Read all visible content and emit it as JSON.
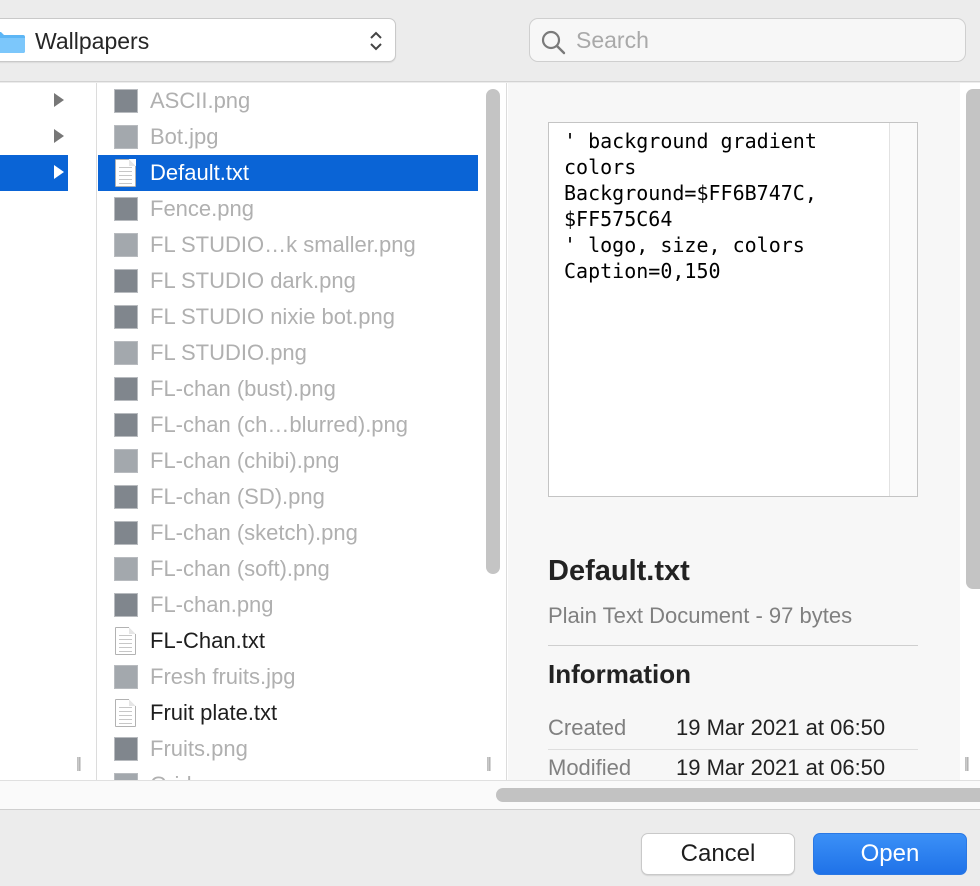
{
  "toolbar": {
    "location": "Wallpapers",
    "search_placeholder": "Search"
  },
  "colors": {
    "selection": "#0a64d6",
    "primary_button": "#1f72e8",
    "disabled_text": "#b0b0b0"
  },
  "files": [
    {
      "name": "ASCII.png",
      "kind": "image",
      "enabled": false,
      "selected": false
    },
    {
      "name": "Bot.jpg",
      "kind": "image",
      "enabled": false,
      "selected": false
    },
    {
      "name": "Default.txt",
      "kind": "text",
      "enabled": true,
      "selected": true
    },
    {
      "name": "Fence.png",
      "kind": "image",
      "enabled": false,
      "selected": false
    },
    {
      "name": "FL STUDIO…k smaller.png",
      "kind": "image",
      "enabled": false,
      "selected": false
    },
    {
      "name": "FL STUDIO dark.png",
      "kind": "image",
      "enabled": false,
      "selected": false
    },
    {
      "name": "FL STUDIO nixie bot.png",
      "kind": "image",
      "enabled": false,
      "selected": false
    },
    {
      "name": "FL STUDIO.png",
      "kind": "image",
      "enabled": false,
      "selected": false
    },
    {
      "name": "FL-chan (bust).png",
      "kind": "image",
      "enabled": false,
      "selected": false
    },
    {
      "name": "FL-chan (ch…blurred).png",
      "kind": "image",
      "enabled": false,
      "selected": false
    },
    {
      "name": "FL-chan (chibi).png",
      "kind": "image",
      "enabled": false,
      "selected": false
    },
    {
      "name": "FL-chan (SD).png",
      "kind": "image",
      "enabled": false,
      "selected": false
    },
    {
      "name": "FL-chan (sketch).png",
      "kind": "image",
      "enabled": false,
      "selected": false
    },
    {
      "name": "FL-chan (soft).png",
      "kind": "image",
      "enabled": false,
      "selected": false
    },
    {
      "name": "FL-chan.png",
      "kind": "image",
      "enabled": false,
      "selected": false
    },
    {
      "name": "FL-Chan.txt",
      "kind": "text",
      "enabled": true,
      "selected": false
    },
    {
      "name": "Fresh fruits.jpg",
      "kind": "image",
      "enabled": false,
      "selected": false
    },
    {
      "name": "Fruit plate.txt",
      "kind": "text",
      "enabled": true,
      "selected": false
    },
    {
      "name": "Fruits.png",
      "kind": "image",
      "enabled": false,
      "selected": false
    },
    {
      "name": "Grid.png",
      "kind": "image",
      "enabled": false,
      "selected": false
    }
  ],
  "preview": {
    "text_content": "' background gradient colors\nBackground=$FF6B747C, $FF575C64\n' logo, size, colors\nCaption=0,150",
    "file_name": "Default.txt",
    "file_kind": "Plain Text Document - 97 bytes",
    "info_heading": "Information",
    "info_rows": [
      {
        "label": "Created",
        "value": "19 Mar 2021 at 06:50"
      },
      {
        "label": "Modified",
        "value": "19 Mar 2021 at 06:50"
      }
    ]
  },
  "buttons": {
    "cancel": "Cancel",
    "open": "Open"
  }
}
